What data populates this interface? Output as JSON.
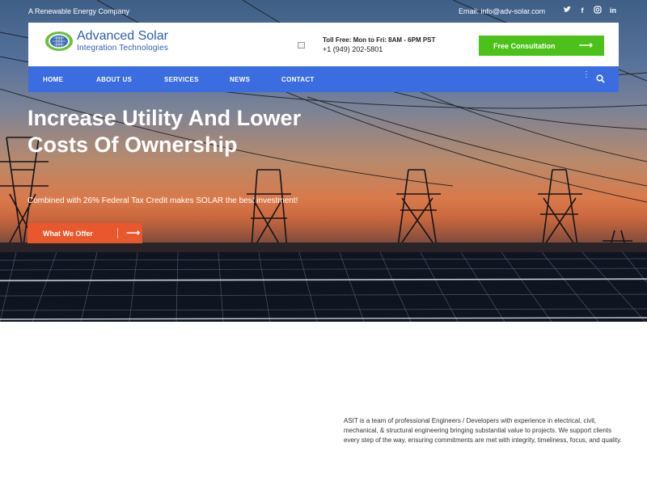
{
  "topbar": {
    "tagline": "A Renewable Energy Company",
    "email": "Email: info@adv-solar.com",
    "socials": [
      "twitter-icon",
      "facebook-icon",
      "instagram-icon",
      "linkedin-icon"
    ]
  },
  "header": {
    "brand_name": "Advanced Solar",
    "brand_sub": "Integration Technologies",
    "toll_free": "Toll Free: Mon to Fri: 8AM - 6PM PST",
    "phone": "+1 (949) 202-5801",
    "consult_label": "Free Consultation",
    "arrow": "⟶"
  },
  "nav": {
    "items": [
      "HOME",
      "ABOUT US",
      "SERVICES",
      "NEWS",
      "CONTACT"
    ],
    "dots": "⋮"
  },
  "hero": {
    "title": "Increase Utility And Lower Costs Of Ownership",
    "subtitle": "Combined with 26% Federal Tax Credit makes SOLAR the best investment!",
    "cta_label": "What We Offer",
    "arrow": "⟶"
  },
  "about": {
    "text": "ASIT is a team of professional Engineers / Developers with experience in electrical, civil, mechanical, & structural engineering bringing substantial value to projects. We support clients every step of the way, ensuring commitments are met with integrity, timeliness, focus, and quality."
  },
  "colors": {
    "brand_blue": "#2b5fa8",
    "nav_blue": "#3b6de0",
    "cta_green": "#4bc11a",
    "cta_orange": "#e8582c"
  }
}
